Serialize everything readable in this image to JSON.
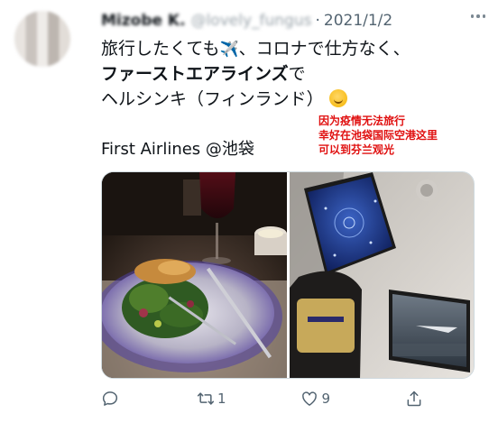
{
  "tweet": {
    "display_name": "Mizobe K.",
    "handle": "@lovely_fungus",
    "separator": "·",
    "date": "2021/1/2",
    "text_line1": "旅行したくても",
    "text_line1_rest": "、コロナで仕方なく、",
    "text_line2_bold": "ファーストエアラインズ",
    "text_line2_rest": "で",
    "text_line3": "ヘルシンキ（フィンランド）",
    "location": "First Airlines @池袋",
    "plane_emoji": "✈️",
    "smile_emoji": "☺️"
  },
  "annotation": {
    "line1": "因为疫情无法旅行",
    "line2": "幸好在池袋国际空港这里",
    "line3": "可以到芬兰观光",
    "color": "#e01010"
  },
  "actions": {
    "reply_count": "",
    "retweet_count": "1",
    "like_count": "9",
    "share_count": ""
  },
  "icons": {
    "more": "more-icon",
    "reply": "reply-icon",
    "retweet": "retweet-icon",
    "like": "like-icon",
    "share": "share-icon"
  },
  "colors": {
    "text": "#0f1419",
    "secondary": "#536471",
    "border": "#cfd9de"
  }
}
